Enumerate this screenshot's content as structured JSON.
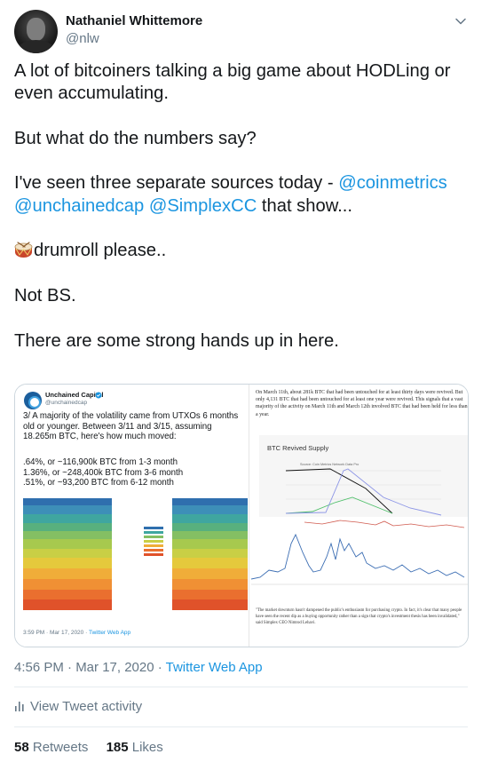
{
  "author": {
    "name": "Nathaniel Whittemore",
    "handle": "@nlw"
  },
  "icons": {
    "menu": "chevron-down-icon",
    "drum": "drum-emoji-icon",
    "activity": "bar-chart-icon"
  },
  "tweet": {
    "p1": "A lot of bitcoiners talking a big game about HODLing or even accumulating.",
    "p2": "But what do the numbers say?",
    "p3_prefix": "I've seen three separate sources today - ",
    "mention1": "@coinmetrics",
    "mention2": "@unchainedcap",
    "mention3": "@SimplexCC",
    "p3_suffix": " that show...",
    "p4": "drumroll please..",
    "p5": "Not BS.",
    "p6": "There are some strong hands up in here."
  },
  "quoted": {
    "name": "Unchained Capital",
    "handle": "@unchainedcap",
    "text": "3/ A majority of the volatility came from UTXOs 6 months old or younger. Between 3/11 and 3/15, assuming 18.265m BTC, here's how much moved:",
    "stat1": ".64%, or ~116,900k BTC from 1-3 month",
    "stat2": "1.36%, or ~248,400k BTC from 3-6 month",
    "stat3": ".51%, or ~93,200 BTC from 6-12 month",
    "time": "3:59 PM · Mar 17, 2020 · ",
    "app": "Twitter Web App",
    "article": "On March 11th, about 281k BTC that had been untouched for at least thirty days were revived. But only 4,131 BTC that had been untouched for at least one year were revived. This signals that a vast majority of the activity on March 11th and March 12th involved BTC that had been held for less than a year.",
    "chart_title": "BTC Revived Supply",
    "chart_source": "Source: Coin Metrics Network Data Pro",
    "quote_caption": "\"The market downturn hasn't dampened the public's enthusiasm for purchasing crypto. In fact, it's clear that many people have seen the recent dip as a buying opportunity rather than a sign that crypto's investment thesis has been invalidated,\" said Simplex CEO Nimrod Lehavi."
  },
  "meta": {
    "time": "4:56 PM · Mar 17, 2020 · ",
    "app": "Twitter Web App"
  },
  "activity": {
    "label": "View Tweet activity"
  },
  "stats": {
    "retweets_count": "58",
    "retweets_label": " Retweets",
    "likes_count": "185",
    "likes_label": " Likes"
  },
  "colors": {
    "link": "#1b95e0",
    "secondary": "#657786",
    "text": "#14171a"
  }
}
